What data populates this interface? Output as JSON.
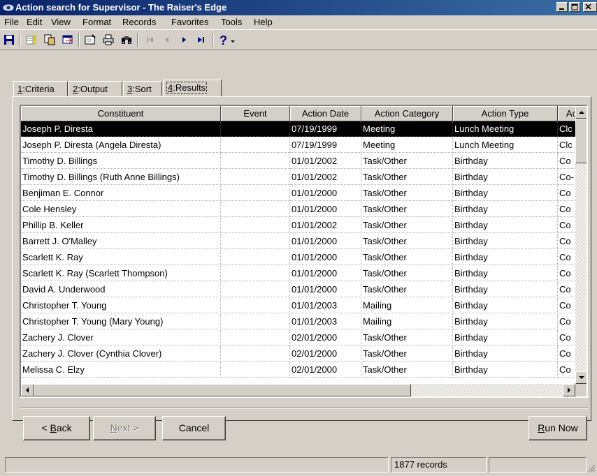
{
  "window": {
    "title": "Action search for Supervisor - The Raiser's Edge"
  },
  "menu": [
    "File",
    "Edit",
    "View",
    "Format",
    "Records",
    "Favorites",
    "Tools",
    "Help"
  ],
  "toolbar": {
    "icons": [
      "save-icon",
      "new-query-icon",
      "copy-icon",
      "export-icon",
      "properties-icon",
      "print-icon",
      "find-icon",
      "first-record-icon",
      "previous-record-icon",
      "next-record-icon",
      "last-record-icon",
      "help-icon"
    ]
  },
  "tabs": [
    {
      "key": "1",
      "label": ":Criteria"
    },
    {
      "key": "2",
      "label": ":Output"
    },
    {
      "key": "3",
      "label": ":Sort"
    },
    {
      "key": "4",
      "label": ":Results",
      "active": true
    }
  ],
  "grid": {
    "columns": [
      "Constituent",
      "Event",
      "Action Date",
      "Action Category",
      "Action Type",
      "Ac"
    ],
    "rows": [
      [
        "Joseph P. Diresta",
        "",
        "07/19/1999",
        "Meeting",
        "Lunch Meeting",
        "Clc"
      ],
      [
        "Joseph P. Diresta (Angela Diresta)",
        "",
        "07/19/1999",
        "Meeting",
        "Lunch Meeting",
        "Clc"
      ],
      [
        "Timothy D. Billings",
        "",
        "01/01/2002",
        "Task/Other",
        "Birthday",
        "Co"
      ],
      [
        "Timothy D. Billings (Ruth Anne Billings)",
        "",
        "01/01/2002",
        "Task/Other",
        "Birthday",
        "Co-"
      ],
      [
        "Benjiman E. Connor",
        "",
        "01/01/2000",
        "Task/Other",
        "Birthday",
        "Co"
      ],
      [
        "Cole Hensley",
        "",
        "01/01/2000",
        "Task/Other",
        "Birthday",
        "Co"
      ],
      [
        "Phillip B. Keller",
        "",
        "01/01/2002",
        "Task/Other",
        "Birthday",
        "Co"
      ],
      [
        "Barrett J. O'Malley",
        "",
        "01/01/2000",
        "Task/Other",
        "Birthday",
        "Co"
      ],
      [
        "Scarlett K. Ray",
        "",
        "01/01/2000",
        "Task/Other",
        "Birthday",
        "Co"
      ],
      [
        "Scarlett K. Ray (Scarlett Thompson)",
        "",
        "01/01/2000",
        "Task/Other",
        "Birthday",
        "Co"
      ],
      [
        "David A. Underwood",
        "",
        "01/01/2000",
        "Task/Other",
        "Birthday",
        "Co"
      ],
      [
        "Christopher T. Young",
        "",
        "01/01/2003",
        "Mailing",
        "Birthday",
        "Co"
      ],
      [
        "Christopher T. Young (Mary Young)",
        "",
        "01/01/2003",
        "Mailing",
        "Birthday",
        "Co"
      ],
      [
        "Zachery J. Clover",
        "",
        "02/01/2000",
        "Task/Other",
        "Birthday",
        "Co"
      ],
      [
        "Zachery J. Clover (Cynthia Clover)",
        "",
        "02/01/2000",
        "Task/Other",
        "Birthday",
        "Co"
      ],
      [
        "Melissa C. Elzy",
        "",
        "02/01/2000",
        "Task/Other",
        "Birthday",
        "Co"
      ]
    ],
    "selected_row": 0
  },
  "buttons": {
    "back": {
      "prefix": "< ",
      "accel": "B",
      "rest": "ack"
    },
    "next": {
      "accel": "N",
      "rest": "ext >"
    },
    "cancel": "Cancel",
    "run_now": {
      "accel": "R",
      "rest": "un Now"
    }
  },
  "status": {
    "record_count": "1877 records"
  }
}
